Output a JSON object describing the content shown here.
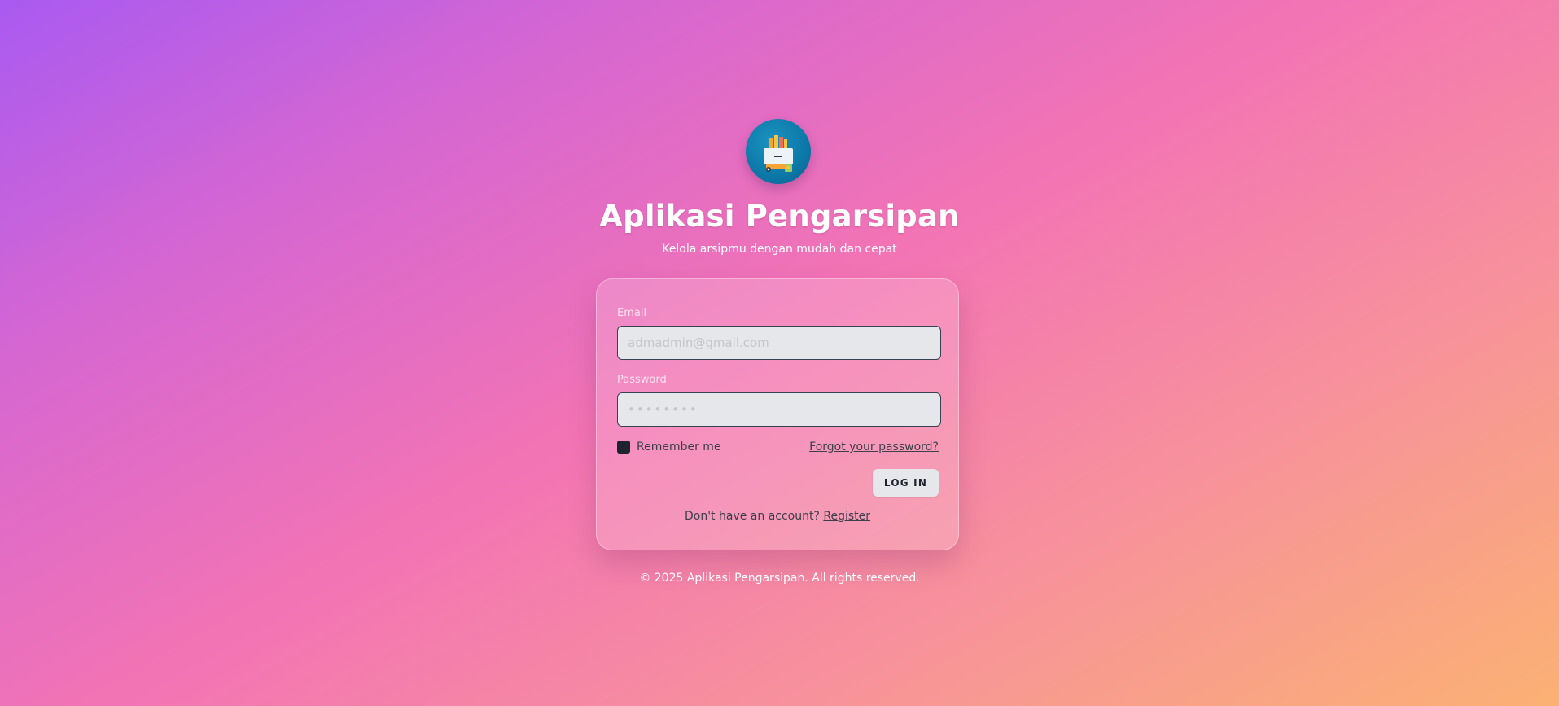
{
  "app": {
    "title": "Aplikasi Pengarsipan",
    "subtitle": "Kelola arsipmu dengan mudah dan cepat",
    "logo_icon": "archive-folders-icon"
  },
  "login_form": {
    "email_label": "Email",
    "email_placeholder": "admadmin@gmail.com",
    "email_value": "",
    "password_label": "Password",
    "password_placeholder": "••••••••",
    "password_value": "",
    "remember_label": "Remember me",
    "remember_checked": true,
    "forgot_label": "Forgot your password?",
    "login_label": "LOG IN",
    "register_prompt": "Don't have an account?",
    "register_label": "Register"
  },
  "footer": {
    "text": "© 2025 Aplikasi Pengarsipan. All rights reserved."
  },
  "colors": {
    "gradient_start": "#a95af1",
    "gradient_mid": "#f374b4",
    "gradient_end": "#fbb173",
    "logo_bg": "#0c78a8",
    "text_dark": "#3b3f4a",
    "field_bg": "#e6e7ea"
  }
}
